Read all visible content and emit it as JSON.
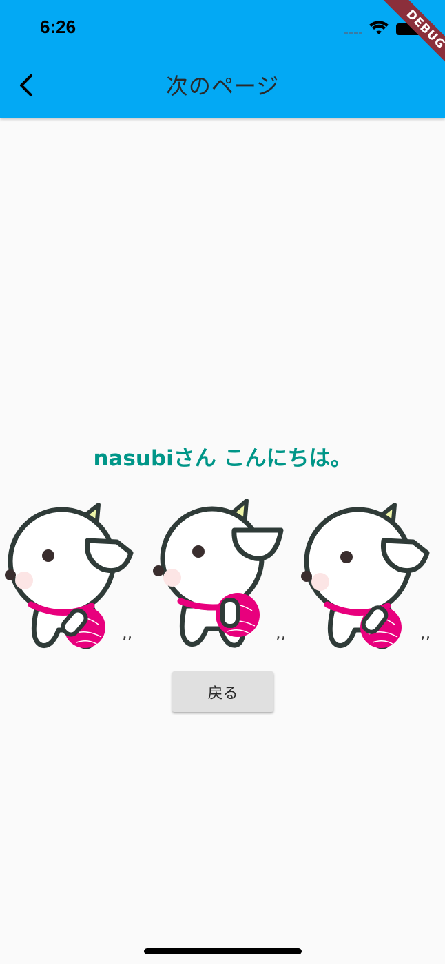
{
  "status_bar": {
    "time": "6:26"
  },
  "debug_banner": "DEBUG",
  "app_bar": {
    "title": "次のページ"
  },
  "main": {
    "greeting": "nasubiさん こんにちは。",
    "back_button_label": "戻る"
  },
  "colors": {
    "app_bar": "#03a9f4",
    "greeting": "#009688",
    "bag": "#e8007d",
    "horn": "#eef5a8"
  },
  "icons": [
    "back-arrow-icon",
    "signal-icon",
    "wifi-icon",
    "battery-icon"
  ]
}
